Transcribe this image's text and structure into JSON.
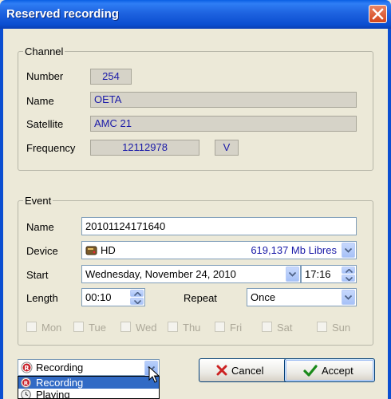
{
  "window": {
    "title": "Reserved recording"
  },
  "channel": {
    "legend": "Channel",
    "number_label": "Number",
    "number_value": "254",
    "name_label": "Name",
    "name_value": "OETA",
    "satellite_label": "Satellite",
    "satellite_value": "AMC 21",
    "frequency_label": "Frequency",
    "frequency_value": "12112978",
    "polarization": "V"
  },
  "event": {
    "legend": "Event",
    "name_label": "Name",
    "name_value": "20101124171640",
    "device_label": "Device",
    "device_value": "HD",
    "device_free": "619,137 Mb Libres",
    "start_label": "Start",
    "start_date": "Wednesday, November 24, 2010",
    "start_time": "17:16",
    "length_label": "Length",
    "length_value": "00:10",
    "repeat_label": "Repeat",
    "repeat_value": "Once",
    "days": [
      "Mon",
      "Tue",
      "Wed",
      "Thu",
      "Fri",
      "Sat",
      "Sun"
    ]
  },
  "mode": {
    "selected": "Recording",
    "options": [
      "Recording",
      "Playing"
    ]
  },
  "buttons": {
    "cancel": "Cancel",
    "accept": "Accept"
  },
  "colors": {
    "titlebar": "#0b4ed1",
    "readonly_text": "#1a1aa8",
    "selection": "#316ac5"
  }
}
